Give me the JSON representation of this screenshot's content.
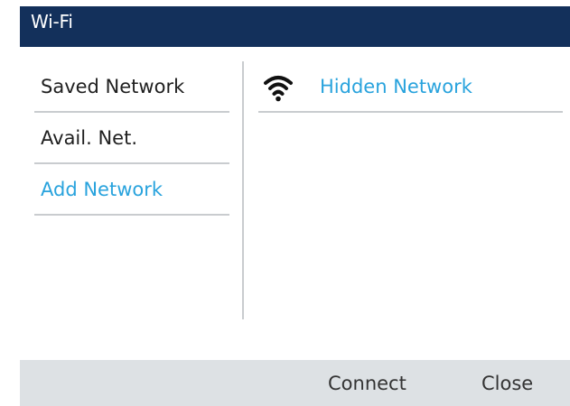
{
  "header": {
    "title": "Wi-Fi"
  },
  "sidebar": {
    "items": [
      {
        "label": "Saved Network"
      },
      {
        "label": "Avail. Net."
      },
      {
        "label": "Add Network"
      }
    ]
  },
  "networks": {
    "items": [
      {
        "name": "Hidden Network",
        "icon": "wifi-icon"
      }
    ]
  },
  "softkeys": {
    "connect": "Connect",
    "close": "Close"
  },
  "colors": {
    "header_bg": "#13305b",
    "accent": "#29a3dd",
    "softkey_bg": "#dde1e4"
  }
}
